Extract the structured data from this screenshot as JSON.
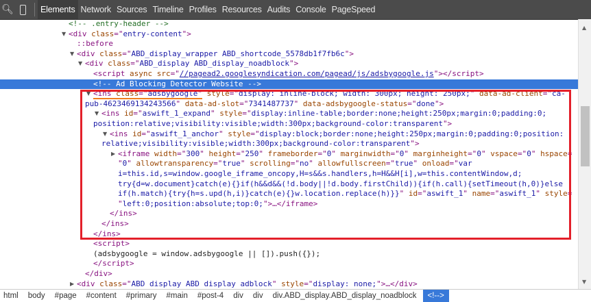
{
  "toolbar": {
    "icons": [
      "search-icon",
      "device-mode-icon"
    ],
    "tabs": [
      {
        "label": "Elements",
        "selected": true
      },
      {
        "label": "Network"
      },
      {
        "label": "Sources"
      },
      {
        "label": "Timeline"
      },
      {
        "label": "Profiles"
      },
      {
        "label": "Resources"
      },
      {
        "label": "Audits"
      },
      {
        "label": "Console"
      },
      {
        "label": "PageSpeed"
      }
    ]
  },
  "colors": {
    "selection": "#3879d9",
    "highlight_box": "#e3202a",
    "underline": "#f07d1e",
    "tag": "#881280",
    "attr_name": "#994500",
    "attr_value": "#1a1aa6",
    "comment": "#236e25"
  },
  "dom_tree": {
    "lines": [
      [
        {
          "t": "<!-- .entry-header -->",
          "k": "cm"
        }
      ],
      [
        {
          "t": "<div ",
          "k": "tag"
        },
        {
          "t": "class",
          "k": "an"
        },
        {
          "t": "=\"",
          "k": "tag"
        },
        {
          "t": "entry-content",
          "k": "av"
        },
        {
          "t": "\">",
          "k": "tag"
        }
      ],
      [
        {
          "t": "::before",
          "k": "tag"
        }
      ],
      [
        {
          "t": "<div ",
          "k": "tag"
        },
        {
          "t": "class",
          "k": "an"
        },
        {
          "t": "=\"",
          "k": "tag"
        },
        {
          "t": "ABD_display_wrapper ABD_shortcode_5578db1f7fb6c",
          "k": "av"
        },
        {
          "t": "\">",
          "k": "tag"
        }
      ],
      [
        {
          "t": "<div ",
          "k": "tag"
        },
        {
          "t": "class",
          "k": "an"
        },
        {
          "t": "=\"",
          "k": "tag"
        },
        {
          "t": "ABD_display ABD_display_noadblock",
          "k": "av"
        },
        {
          "t": "\">",
          "k": "tag"
        }
      ],
      [
        {
          "t": "<script ",
          "k": "tag"
        },
        {
          "t": "async src",
          "k": "an"
        },
        {
          "t": "=\"",
          "k": "tag"
        },
        {
          "t": "//pagead2.googlesyndication.com/pagead/js/adsbygoogle.js",
          "k": "lk"
        },
        {
          "t": "\"></script>",
          "k": "tag"
        }
      ],
      [
        {
          "t": "<!-- Ad Blocking Detector Website -->",
          "k": "cm"
        }
      ],
      [
        {
          "t": "<ins ",
          "k": "tag ul"
        },
        {
          "t": "class",
          "k": "an ul"
        },
        {
          "t": "=\"",
          "k": "tag ul"
        },
        {
          "t": "adsbygoogle",
          "k": "av ul"
        },
        {
          "t": "\"",
          "k": "tag ul"
        },
        {
          "t": " style",
          "k": "an"
        },
        {
          "t": "=\"",
          "k": "tag"
        },
        {
          "t": "display: inline-block; width: 300px; height: 250px;",
          "k": "av"
        },
        {
          "t": "\" ",
          "k": "tag"
        },
        {
          "t": "data-ad-client",
          "k": "an"
        },
        {
          "t": "=\"",
          "k": "tag"
        },
        {
          "t": "ca-",
          "k": "av"
        }
      ],
      [
        {
          "t": "pub-4623469134243566",
          "k": "av"
        },
        {
          "t": "\" ",
          "k": "tag"
        },
        {
          "t": "data-ad-slot",
          "k": "an"
        },
        {
          "t": "=\"",
          "k": "tag"
        },
        {
          "t": "7341487737",
          "k": "av"
        },
        {
          "t": "\" ",
          "k": "tag"
        },
        {
          "t": "data-adsbygoogle-status",
          "k": "an"
        },
        {
          "t": "=\"",
          "k": "tag"
        },
        {
          "t": "done",
          "k": "av"
        },
        {
          "t": "\">",
          "k": "tag"
        }
      ],
      [
        {
          "t": "<ins ",
          "k": "tag"
        },
        {
          "t": "id",
          "k": "an"
        },
        {
          "t": "=\"",
          "k": "tag"
        },
        {
          "t": "aswift_1_expand",
          "k": "av"
        },
        {
          "t": "\" ",
          "k": "tag"
        },
        {
          "t": "style",
          "k": "an"
        },
        {
          "t": "=\"",
          "k": "tag"
        },
        {
          "t": "display:inline-table;border:none;height:250px;margin:0;padding:0;",
          "k": "av"
        }
      ],
      [
        {
          "t": "position:relative;visibility:visible;width:300px;background-color:transparent",
          "k": "av"
        },
        {
          "t": "\">",
          "k": "tag"
        }
      ],
      [
        {
          "t": "<ins ",
          "k": "tag"
        },
        {
          "t": "id",
          "k": "an"
        },
        {
          "t": "=\"",
          "k": "tag"
        },
        {
          "t": "aswift_1_anchor",
          "k": "av"
        },
        {
          "t": "\" ",
          "k": "tag"
        },
        {
          "t": "style",
          "k": "an"
        },
        {
          "t": "=\"",
          "k": "tag"
        },
        {
          "t": "display:block;border:none;height:250px;margin:0;padding:0;position:",
          "k": "av"
        }
      ],
      [
        {
          "t": "relative;visibility:visible;width:300px;background-color:transparent",
          "k": "av"
        },
        {
          "t": "\">",
          "k": "tag"
        }
      ],
      [
        {
          "t": "<iframe ",
          "k": "tag"
        },
        {
          "t": "width",
          "k": "an"
        },
        {
          "t": "=\"",
          "k": "tag"
        },
        {
          "t": "300",
          "k": "av"
        },
        {
          "t": "\" ",
          "k": "tag"
        },
        {
          "t": "height",
          "k": "an"
        },
        {
          "t": "=\"",
          "k": "tag"
        },
        {
          "t": "250",
          "k": "av"
        },
        {
          "t": "\" ",
          "k": "tag"
        },
        {
          "t": "frameborder",
          "k": "an"
        },
        {
          "t": "=\"",
          "k": "tag"
        },
        {
          "t": "0",
          "k": "av"
        },
        {
          "t": "\" ",
          "k": "tag"
        },
        {
          "t": "marginwidth",
          "k": "an"
        },
        {
          "t": "=\"",
          "k": "tag"
        },
        {
          "t": "0",
          "k": "av"
        },
        {
          "t": "\" ",
          "k": "tag"
        },
        {
          "t": "marginheight",
          "k": "an"
        },
        {
          "t": "=\"",
          "k": "tag"
        },
        {
          "t": "0",
          "k": "av"
        },
        {
          "t": "\" ",
          "k": "tag"
        },
        {
          "t": "vspace",
          "k": "an"
        },
        {
          "t": "=\"",
          "k": "tag"
        },
        {
          "t": "0",
          "k": "av"
        },
        {
          "t": "\" ",
          "k": "tag"
        },
        {
          "t": "hspace",
          "k": "an"
        },
        {
          "t": "=",
          "k": "tag"
        }
      ],
      [
        {
          "t": "\"",
          "k": "tag"
        },
        {
          "t": "0",
          "k": "av"
        },
        {
          "t": "\" ",
          "k": "tag"
        },
        {
          "t": "allowtransparency",
          "k": "an"
        },
        {
          "t": "=\"",
          "k": "tag"
        },
        {
          "t": "true",
          "k": "av"
        },
        {
          "t": "\" ",
          "k": "tag"
        },
        {
          "t": "scrolling",
          "k": "an"
        },
        {
          "t": "=\"",
          "k": "tag"
        },
        {
          "t": "no",
          "k": "av"
        },
        {
          "t": "\" ",
          "k": "tag"
        },
        {
          "t": "allowfullscreen",
          "k": "an"
        },
        {
          "t": "=\"",
          "k": "tag"
        },
        {
          "t": "true",
          "k": "av"
        },
        {
          "t": "\" ",
          "k": "tag"
        },
        {
          "t": "onload",
          "k": "an"
        },
        {
          "t": "=\"",
          "k": "tag"
        },
        {
          "t": "var",
          "k": "av"
        }
      ],
      [
        {
          "t": "i=this.id,s=window.google_iframe_oncopy,H=s&&s.handlers,h=H&&H[i],w=this.contentWindow,d;",
          "k": "av"
        }
      ],
      [
        {
          "t": "try{d=w.document}catch(e){}if(h&&d&&(!d.body||!d.body.firstChild)){if(h.call){setTimeout(h,0)}else",
          "k": "av"
        }
      ],
      [
        {
          "t": "if(h.match){try{h=s.upd(h,i)}catch(e){}w.location.replace(h)}}",
          "k": "av"
        },
        {
          "t": "\" ",
          "k": "tag"
        },
        {
          "t": "id",
          "k": "an"
        },
        {
          "t": "=\"",
          "k": "tag"
        },
        {
          "t": "aswift_1",
          "k": "av"
        },
        {
          "t": "\" ",
          "k": "tag"
        },
        {
          "t": "name",
          "k": "an"
        },
        {
          "t": "=\"",
          "k": "tag"
        },
        {
          "t": "aswift_1",
          "k": "av"
        },
        {
          "t": "\" ",
          "k": "tag"
        },
        {
          "t": "style",
          "k": "an"
        },
        {
          "t": "=",
          "k": "tag"
        }
      ],
      [
        {
          "t": "\"",
          "k": "tag"
        },
        {
          "t": "left:0;position:absolute;top:0;",
          "k": "av"
        },
        {
          "t": "\">…</iframe>",
          "k": "tag"
        }
      ],
      [
        {
          "t": "</ins>",
          "k": "tag"
        }
      ],
      [
        {
          "t": "</ins>",
          "k": "tag"
        }
      ],
      [
        {
          "t": "</ins>",
          "k": "tag"
        }
      ],
      [
        {
          "t": "<script>",
          "k": "tag"
        }
      ],
      [
        {
          "t": "(adsbygoogle = window.adsbygoogle || []).push({});",
          "k": "tx"
        }
      ],
      [
        {
          "t": "</script>",
          "k": "tag"
        }
      ],
      [
        {
          "t": "</div>",
          "k": "tag"
        }
      ],
      [
        {
          "t": "<div ",
          "k": "tag"
        },
        {
          "t": "class",
          "k": "an"
        },
        {
          "t": "=\"",
          "k": "tag"
        },
        {
          "t": "ABD display ABD display adblock",
          "k": "av"
        },
        {
          "t": "\" ",
          "k": "tag"
        },
        {
          "t": "style",
          "k": "an"
        },
        {
          "t": "=\"",
          "k": "tag"
        },
        {
          "t": "display: none;",
          "k": "av"
        },
        {
          "t": "\">…</div>",
          "k": "tag"
        }
      ]
    ],
    "selected_line": 6
  },
  "breadcrumbs": [
    {
      "label": "html"
    },
    {
      "label": "body"
    },
    {
      "label": "#page"
    },
    {
      "label": "#content"
    },
    {
      "label": "#primary"
    },
    {
      "label": "#main"
    },
    {
      "label": "#post-4"
    },
    {
      "label": "div"
    },
    {
      "label": "div"
    },
    {
      "label": "div.ABD_display.ABD_display_noadblock"
    },
    {
      "label": "<!-->",
      "selected": true
    }
  ]
}
